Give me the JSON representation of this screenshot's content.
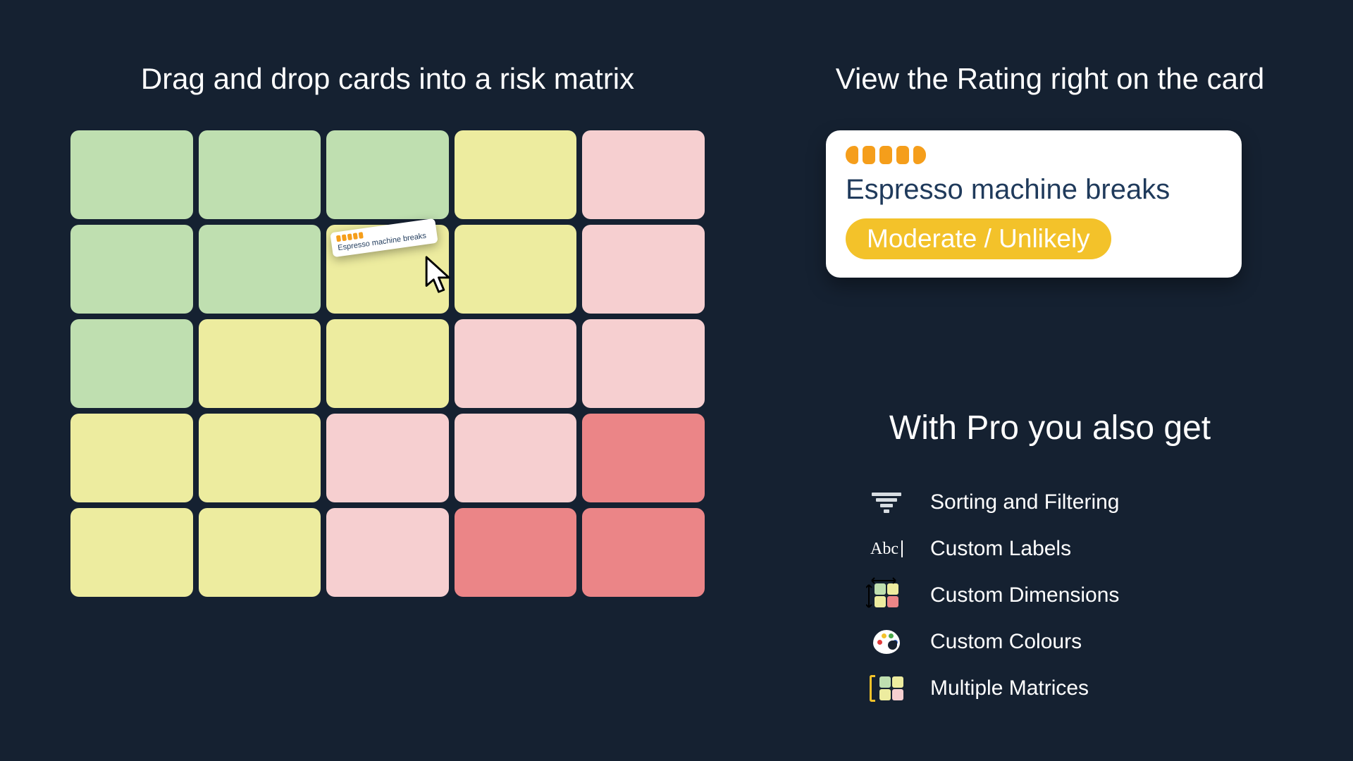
{
  "left": {
    "title": "Drag and drop cards into a risk matrix",
    "matrix_colors": [
      [
        "g",
        "g",
        "g",
        "y",
        "p"
      ],
      [
        "g",
        "g",
        "y",
        "y",
        "p"
      ],
      [
        "g",
        "y",
        "y",
        "p",
        "p"
      ],
      [
        "y",
        "y",
        "p",
        "p",
        "r"
      ],
      [
        "y",
        "y",
        "p",
        "r",
        "r"
      ]
    ],
    "drag_card_label": "Espresso machine breaks"
  },
  "right": {
    "title": "View the Rating right on the card",
    "card": {
      "title": "Espresso machine breaks",
      "badge": "Moderate / Unlikely"
    }
  },
  "pro": {
    "title": "With Pro you also get",
    "features": [
      "Sorting and Filtering",
      "Custom Labels",
      "Custom Dimensions",
      "Custom Colours",
      "Multiple Matrices"
    ],
    "abc_icon_text": "Abc"
  }
}
